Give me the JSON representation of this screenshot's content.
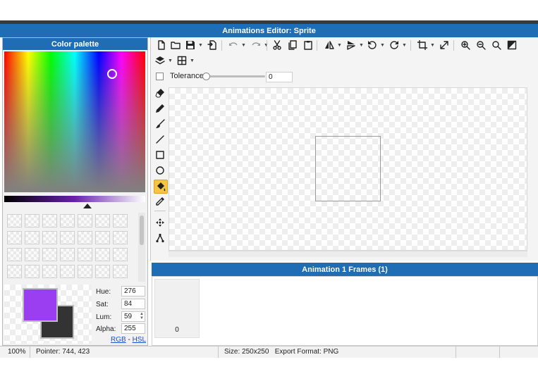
{
  "window": {
    "title": "Animations Editor: Sprite"
  },
  "palette": {
    "title": "Color palette",
    "primary_color": "#9b3df0",
    "secondary_color": "#333333",
    "hue_label": "Hue:",
    "hue": "276",
    "sat_label": "Sat:",
    "sat": "84",
    "lum_label": "Lum:",
    "lum": "59",
    "alpha_label": "Alpha:",
    "alpha": "255",
    "rgb_link": "RGB",
    "separator": "-",
    "hsl_link": "HSL"
  },
  "toolbar": {
    "icons": [
      "new-file-icon",
      "open-folder-icon",
      "save-icon",
      "export-icon",
      "undo-icon",
      "redo-icon",
      "cut-icon",
      "copy-icon",
      "paste-icon",
      "flip-horizontal-icon",
      "flip-vertical-icon",
      "rotate-left-icon",
      "rotate-right-icon",
      "crop-icon",
      "resize-icon",
      "zoom-in-icon",
      "zoom-out-icon",
      "zoom-fit-icon",
      "invert-icon",
      "layers-icon",
      "grid-icon"
    ]
  },
  "tool_options": {
    "tolerance_label": "Tolerance",
    "tolerance_value": "0",
    "tolerance_fraction": 0
  },
  "tools": [
    "eraser-icon",
    "pencil-icon",
    "brush-icon",
    "line-icon",
    "rectangle-icon",
    "ellipse-icon",
    "fill-bucket-icon",
    "eyedropper-icon",
    "move-point-icon",
    "bone-icon"
  ],
  "frames": {
    "title": "Animation 1 Frames (1)",
    "items": [
      {
        "label": "0"
      }
    ]
  },
  "status": {
    "zoom": "100%",
    "pointer": "Pointer: 744, 423",
    "size": "Size: 250x250",
    "export_format": "Export Format: PNG"
  }
}
